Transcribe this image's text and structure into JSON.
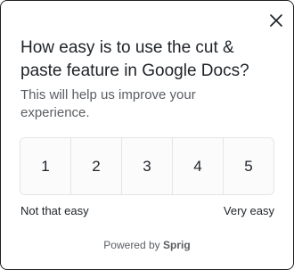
{
  "survey": {
    "question": "How easy is to use the cut & paste feature in Google Docs?",
    "subtitle": "This will help us improve your experience.",
    "scale": [
      "1",
      "2",
      "3",
      "4",
      "5"
    ],
    "min_label": "Not that easy",
    "max_label": "Very easy",
    "powered_by_prefix": "Powered by",
    "powered_by_brand": "Sprig",
    "close_icon": "close-icon"
  }
}
